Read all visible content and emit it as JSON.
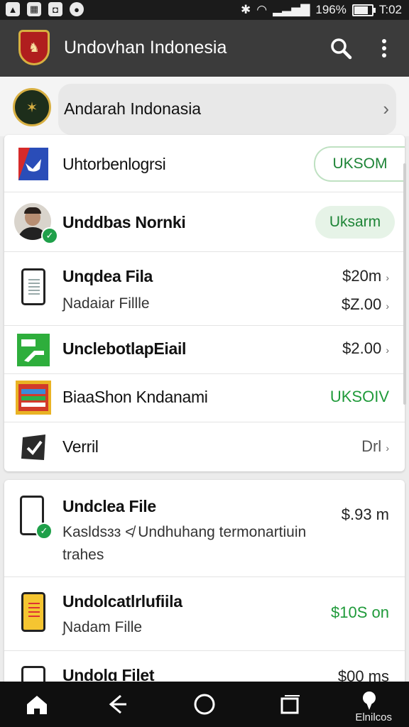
{
  "status_bar": {
    "left_icons": [
      "photo-icon",
      "gallery-icon",
      "shield-icon",
      "app-icon"
    ],
    "battery": "196%",
    "battery_fill": 0.85,
    "time": "T:02"
  },
  "app_bar": {
    "title": "Undovhan Indonesia",
    "actions": [
      "search-icon",
      "more-vert-icon"
    ]
  },
  "header_item": {
    "label": "Andarah Indonasia",
    "chevron": "›"
  },
  "list_card": [
    {
      "icon": "flag-icon",
      "title": "Uhtorbenlogrsi",
      "title_style": "regular",
      "badge": "UKSOM",
      "badge_style": "outline"
    },
    {
      "icon": "avatar",
      "title": "Unddbas Nornki",
      "badge": "Uksarm",
      "badge_style": "pill",
      "verified": true
    },
    {
      "icon": "phone-doc-icon",
      "title": "Unqdea Fila",
      "subtitle": "Ɲadaiar Fillle",
      "price": "$20m",
      "price2": "$Z.00"
    },
    {
      "icon": "green-app-icon",
      "title": "UnclebotlapEiail",
      "price": "$2.00"
    },
    {
      "icon": "book-icon",
      "title": "BiaaShon Kndanami",
      "title_style": "regular",
      "badge": "UKSOIV",
      "badge_style": "text"
    },
    {
      "icon": "verify-icon",
      "title": "Verril",
      "title_style": "regular",
      "price": "Drl"
    }
  ],
  "list_card_2": [
    {
      "icon": "phone-icon",
      "title": "Undclea File",
      "subtitle": "Kasldsɜɜ ≮ Undhuhang termonartiuin",
      "subtitle2": "trahes",
      "price": "$.93 m",
      "verified": true
    },
    {
      "icon": "phone-yellow-icon",
      "title": "Undolcatlrlufiila",
      "subtitle": "Ɲadam Fille",
      "price": "$10S on"
    },
    {
      "icon": "phone-icon",
      "title": "Undolɑ Filet",
      "price": "$00 ms"
    }
  ],
  "nav_bar": {
    "items": [
      "home-icon",
      "back-icon",
      "home-circle-icon",
      "recents-icon",
      "assistant-icon"
    ],
    "label": "Elnilcos"
  },
  "colors": {
    "app_bar": "#3b3b3b",
    "status_bar": "#1b1b1b",
    "accent_green": "#1f9a3a"
  }
}
